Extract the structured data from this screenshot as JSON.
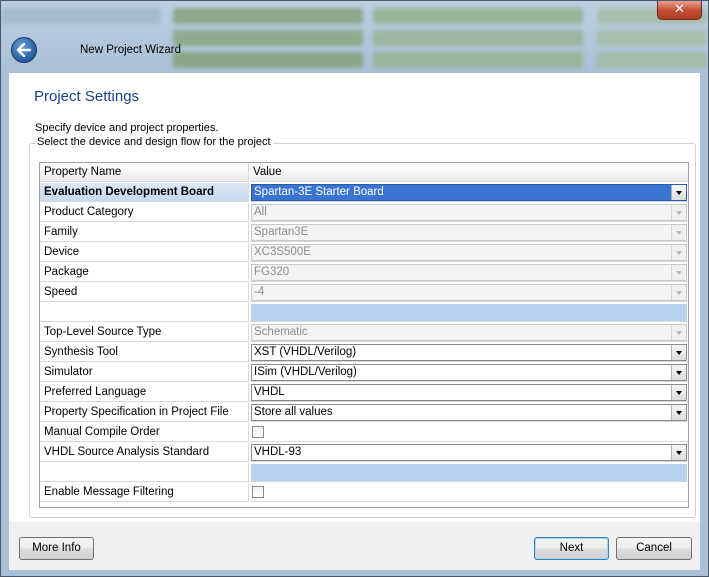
{
  "window": {
    "title": "New Project Wizard",
    "close_label": "✕"
  },
  "section": {
    "title": "Project Settings",
    "description": "Specify device and project properties.",
    "group_label": "Select the device and design flow for the project"
  },
  "grid": {
    "header": {
      "name": "Property Name",
      "value": "Value"
    },
    "rows": [
      {
        "name": "Evaluation Development Board",
        "value": "Spartan-3E Starter Board",
        "kind": "combo",
        "state": "selected"
      },
      {
        "name": "Product Category",
        "value": "All",
        "kind": "combo",
        "state": "disabled"
      },
      {
        "name": "Family",
        "value": "Spartan3E",
        "kind": "combo",
        "state": "disabled"
      },
      {
        "name": "Device",
        "value": "XC3S500E",
        "kind": "combo",
        "state": "disabled"
      },
      {
        "name": "Package",
        "value": "FG320",
        "kind": "combo",
        "state": "disabled"
      },
      {
        "name": "Speed",
        "value": "-4",
        "kind": "combo",
        "state": "disabled"
      },
      {
        "name": "",
        "value": "",
        "kind": "separator",
        "state": ""
      },
      {
        "name": "Top-Level Source Type",
        "value": "Schematic",
        "kind": "combo",
        "state": "disabled"
      },
      {
        "name": "Synthesis Tool",
        "value": "XST (VHDL/Verilog)",
        "kind": "combo",
        "state": "enabled"
      },
      {
        "name": "Simulator",
        "value": "ISim (VHDL/Verilog)",
        "kind": "combo",
        "state": "enabled"
      },
      {
        "name": "Preferred Language",
        "value": "VHDL",
        "kind": "combo",
        "state": "enabled"
      },
      {
        "name": "Property Specification in Project File",
        "value": "Store all values",
        "kind": "combo",
        "state": "enabled"
      },
      {
        "name": "Manual Compile Order",
        "value": "",
        "kind": "checkbox",
        "checked": false
      },
      {
        "name": "VHDL Source Analysis Standard",
        "value": "VHDL-93",
        "kind": "combo",
        "state": "enabled"
      },
      {
        "name": "",
        "value": "",
        "kind": "separator",
        "state": ""
      },
      {
        "name": "Enable Message Filtering",
        "value": "",
        "kind": "checkbox",
        "checked": false
      }
    ]
  },
  "buttons": {
    "more_info": "More Info",
    "next": "Next",
    "cancel": "Cancel"
  },
  "colors": {
    "accent": "#1e3f8a",
    "selection": "#3a74d2",
    "separator": "#b8d1ee"
  }
}
